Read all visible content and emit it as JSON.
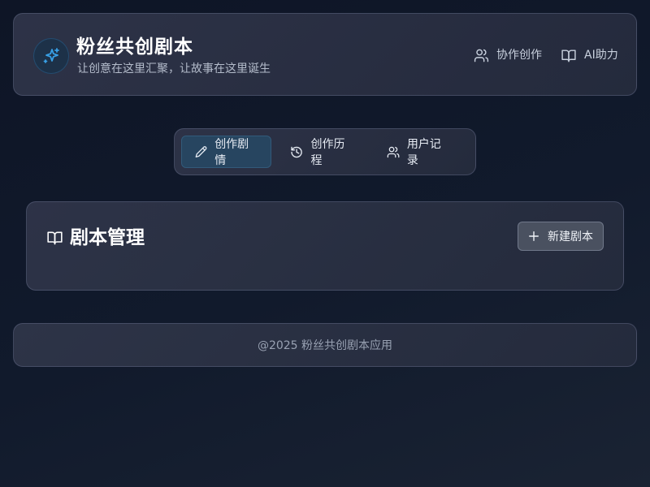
{
  "header": {
    "title": "粉丝共创剧本",
    "subtitle": "让创意在这里汇聚，让故事在这里诞生",
    "logo_icon": "sparkles-icon",
    "links": [
      {
        "label": "协作创作",
        "icon": "users-icon"
      },
      {
        "label": "AI助力",
        "icon": "book-open-icon"
      }
    ]
  },
  "tabs": [
    {
      "label": "创作剧情",
      "icon": "pencil-icon",
      "active": true
    },
    {
      "label": "创作历程",
      "icon": "history-icon",
      "active": false
    },
    {
      "label": "用户记录",
      "icon": "users-icon",
      "active": false
    }
  ],
  "panel": {
    "title": "剧本管理",
    "title_icon": "book-open-icon",
    "new_button_label": "新建剧本",
    "new_button_icon": "plus-icon"
  },
  "footer": {
    "text": "@2025 粉丝共创剧本应用"
  },
  "colors": {
    "accent": "#38a0e6",
    "active_tab_bg": "#274560",
    "background": "#0e1526"
  }
}
